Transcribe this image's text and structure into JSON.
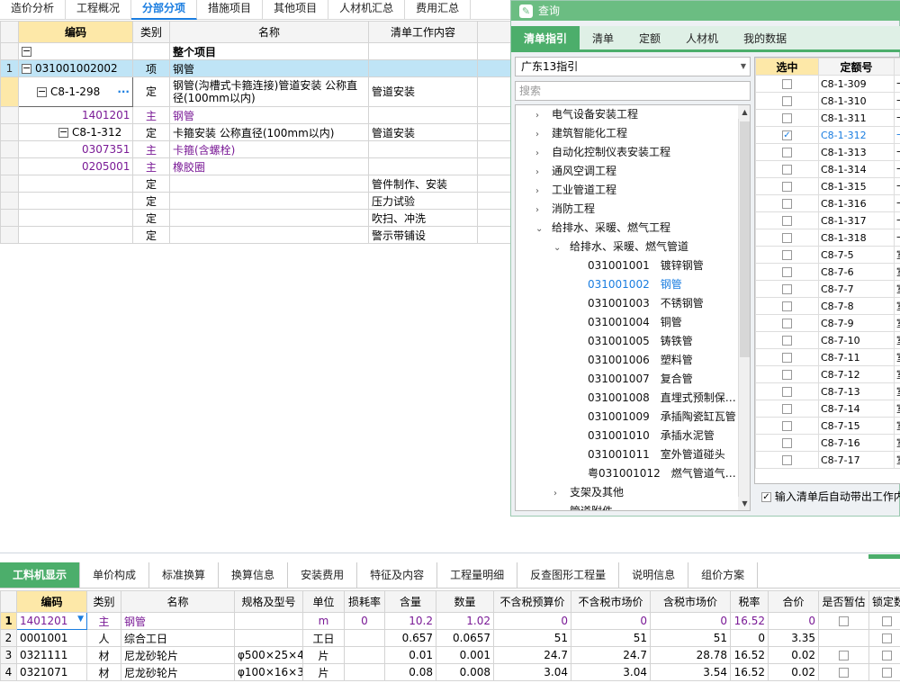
{
  "top_tabs": [
    "造价分析",
    "工程概况",
    "分部分项",
    "措施项目",
    "其他项目",
    "人材机汇总",
    "费用汇总"
  ],
  "top_tabs_active": 2,
  "left_grid": {
    "headers": [
      "编码",
      "类别",
      "名称",
      "清单工作内容"
    ],
    "whole_project": "整个项目",
    "rows": [
      {
        "rn": "1",
        "code": "031001002002",
        "type": "项",
        "name": "钢管",
        "work": ""
      },
      {
        "rn": "",
        "code": "C8-1-298",
        "type": "定",
        "name": "钢管(沟槽式卡箍连接)管道安装 公称直径(100mm以内)",
        "work": "管道安装"
      },
      {
        "rn": "",
        "code": "1401201",
        "type": "主",
        "name": "钢管",
        "work": ""
      },
      {
        "rn": "",
        "code": "C8-1-312",
        "type": "定",
        "name": "卡箍安装 公称直径(100mm以内)",
        "work": "管道安装"
      },
      {
        "rn": "",
        "code": "0307351",
        "type": "主",
        "name": "卡箍(含螺栓)",
        "work": ""
      },
      {
        "rn": "",
        "code": "0205001",
        "type": "主",
        "name": "橡胶圈",
        "work": ""
      },
      {
        "rn": "",
        "code": "",
        "type": "定",
        "name": "",
        "work": "管件制作、安装"
      },
      {
        "rn": "",
        "code": "",
        "type": "定",
        "name": "",
        "work": "压力试验"
      },
      {
        "rn": "",
        "code": "",
        "type": "定",
        "name": "",
        "work": "吹扫、冲洗"
      },
      {
        "rn": "",
        "code": "",
        "type": "定",
        "name": "",
        "work": "警示带铺设"
      }
    ]
  },
  "query": {
    "title": "查询",
    "tabs": [
      "清单指引",
      "清单",
      "定额",
      "人材机",
      "我的数据"
    ],
    "select_value": "广东13指引",
    "search_placeholder": "搜索",
    "tree": [
      {
        "label": "电气设备安装工程",
        "level": 0,
        "arrow": "›"
      },
      {
        "label": "建筑智能化工程",
        "level": 0,
        "arrow": "›"
      },
      {
        "label": "自动化控制仪表安装工程",
        "level": 0,
        "arrow": "›"
      },
      {
        "label": "通风空调工程",
        "level": 0,
        "arrow": "›"
      },
      {
        "label": "工业管道工程",
        "level": 0,
        "arrow": "›"
      },
      {
        "label": "消防工程",
        "level": 0,
        "arrow": "›"
      },
      {
        "label": "给排水、采暖、燃气工程",
        "level": 0,
        "arrow": "⌄"
      },
      {
        "label": "给排水、采暖、燃气管道",
        "level": 1,
        "arrow": "⌄"
      },
      {
        "label": "031001001　镀锌钢管",
        "level": 2,
        "arrow": ""
      },
      {
        "label": "031001002　钢管",
        "level": 2,
        "arrow": "",
        "hl": true
      },
      {
        "label": "031001003　不锈钢管",
        "level": 2,
        "arrow": ""
      },
      {
        "label": "031001004　铜管",
        "level": 2,
        "arrow": ""
      },
      {
        "label": "031001005　铸铁管",
        "level": 2,
        "arrow": ""
      },
      {
        "label": "031001006　塑料管",
        "level": 2,
        "arrow": ""
      },
      {
        "label": "031001007　复合管",
        "level": 2,
        "arrow": ""
      },
      {
        "label": "031001008　直埋式预制保…",
        "level": 2,
        "arrow": ""
      },
      {
        "label": "031001009　承插陶瓷缸瓦管",
        "level": 2,
        "arrow": ""
      },
      {
        "label": "031001010　承插水泥管",
        "level": 2,
        "arrow": ""
      },
      {
        "label": "031001011　室外管道碰头",
        "level": 2,
        "arrow": ""
      },
      {
        "label": "粤031001012　燃气管道气…",
        "level": 2,
        "arrow": ""
      },
      {
        "label": "支架及其他",
        "level": 1,
        "arrow": "›"
      },
      {
        "label": "管道附件",
        "level": 1,
        "arrow": "›"
      }
    ],
    "right_headers": [
      "选中",
      "定额号"
    ],
    "right_rows": [
      {
        "code": "C8-1-309",
        "tail": "卡",
        "checked": false
      },
      {
        "code": "C8-1-310",
        "tail": "卡",
        "checked": false
      },
      {
        "code": "C8-1-311",
        "tail": "卡",
        "checked": false
      },
      {
        "code": "C8-1-312",
        "tail": "卡",
        "checked": true
      },
      {
        "code": "C8-1-313",
        "tail": "卡",
        "checked": false
      },
      {
        "code": "C8-1-314",
        "tail": "卡",
        "checked": false
      },
      {
        "code": "C8-1-315",
        "tail": "卡",
        "checked": false
      },
      {
        "code": "C8-1-316",
        "tail": "卡",
        "checked": false
      },
      {
        "code": "C8-1-317",
        "tail": "卡",
        "checked": false
      },
      {
        "code": "C8-1-318",
        "tail": "卡",
        "checked": false
      },
      {
        "code": "C8-7-5",
        "tail": "室",
        "checked": false
      },
      {
        "code": "C8-7-6",
        "tail": "室",
        "checked": false
      },
      {
        "code": "C8-7-7",
        "tail": "室",
        "checked": false
      },
      {
        "code": "C8-7-8",
        "tail": "室",
        "checked": false
      },
      {
        "code": "C8-7-9",
        "tail": "室",
        "checked": false
      },
      {
        "code": "C8-7-10",
        "tail": "室",
        "checked": false
      },
      {
        "code": "C8-7-11",
        "tail": "室",
        "checked": false
      },
      {
        "code": "C8-7-12",
        "tail": "室",
        "checked": false
      },
      {
        "code": "C8-7-13",
        "tail": "室",
        "checked": false
      },
      {
        "code": "C8-7-14",
        "tail": "室",
        "checked": false
      },
      {
        "code": "C8-7-15",
        "tail": "室",
        "checked": false
      },
      {
        "code": "C8-7-16",
        "tail": "室",
        "checked": false
      },
      {
        "code": "C8-7-17",
        "tail": "室",
        "checked": false
      }
    ],
    "footer_checkbox": "输入清单后自动带出工作内容"
  },
  "bottom_tabs": [
    "工料机显示",
    "单价构成",
    "标准换算",
    "换算信息",
    "安装费用",
    "特征及内容",
    "工程量明细",
    "反查图形工程量",
    "说明信息",
    "组价方案"
  ],
  "bottom_tabs_active": 0,
  "bottom_grid": {
    "headers": [
      "编码",
      "类别",
      "名称",
      "规格及型号",
      "单位",
      "损耗率",
      "含量",
      "数量",
      "不含税预算价",
      "不含税市场价",
      "含税市场价",
      "税率",
      "合价",
      "是否暂估",
      "锁定数"
    ],
    "rows": [
      {
        "rn": "1",
        "code": "1401201",
        "type": "主",
        "name": "钢管",
        "spec": "",
        "unit": "m",
        "loss": "0",
        "content": "10.2",
        "qty": "1.02",
        "p1": "0",
        "p2": "0",
        "p3": "0",
        "tax": "16.52",
        "total": "0"
      },
      {
        "rn": "2",
        "code": "0001001",
        "type": "人",
        "name": "综合工日",
        "spec": "",
        "unit": "工日",
        "loss": "",
        "content": "0.657",
        "qty": "0.0657",
        "p1": "51",
        "p2": "51",
        "p3": "51",
        "tax": "0",
        "total": "3.35"
      },
      {
        "rn": "3",
        "code": "0321111",
        "type": "材",
        "name": "尼龙砂轮片",
        "spec": "φ500×25×4",
        "unit": "片",
        "loss": "",
        "content": "0.01",
        "qty": "0.001",
        "p1": "24.7",
        "p2": "24.7",
        "p3": "28.78",
        "tax": "16.52",
        "total": "0.02"
      },
      {
        "rn": "4",
        "code": "0321071",
        "type": "材",
        "name": "尼龙砂轮片",
        "spec": "φ100×16×3",
        "unit": "片",
        "loss": "",
        "content": "0.08",
        "qty": "0.008",
        "p1": "3.04",
        "p2": "3.04",
        "p3": "3.54",
        "tax": "16.52",
        "total": "0.02"
      }
    ]
  }
}
